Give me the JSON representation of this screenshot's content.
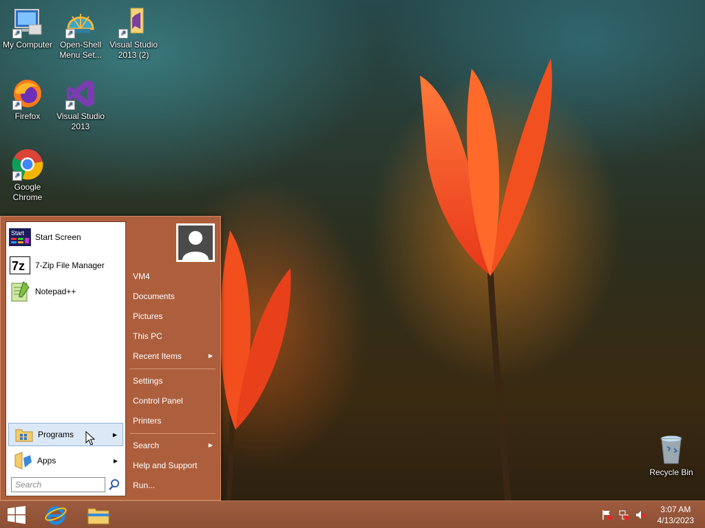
{
  "desktop": {
    "icons": [
      {
        "name": "My Computer",
        "line1": "My Computer",
        "line2": ""
      },
      {
        "name": "Open-Shell Menu Settings",
        "line1": "Open-Shell",
        "line2": "Menu Set..."
      },
      {
        "name": "Visual Studio 2013 (2)",
        "line1": "Visual Studio",
        "line2": "2013 (2)"
      },
      {
        "name": "Firefox",
        "line1": "Firefox",
        "line2": ""
      },
      {
        "name": "Visual Studio 2013",
        "line1": "Visual Studio",
        "line2": "2013"
      },
      {
        "name": "Google Chrome",
        "line1": "Google",
        "line2": "Chrome"
      },
      {
        "name": "Recycle Bin",
        "line1": "Recycle Bin",
        "line2": ""
      }
    ]
  },
  "start_menu": {
    "pinned": [
      {
        "label": "Start Screen"
      },
      {
        "label": "7-Zip File Manager"
      },
      {
        "label": "Notepad++"
      }
    ],
    "programs_label": "Programs",
    "apps_label": "Apps",
    "search_placeholder": "Search",
    "start_screen_icon_text": "Start",
    "sevenzip_icon_text": "7z",
    "right_items": [
      {
        "label": "VM4"
      },
      {
        "label": "Documents"
      },
      {
        "label": "Pictures"
      },
      {
        "label": "This PC"
      },
      {
        "label": "Recent Items"
      },
      {
        "label": "Settings"
      },
      {
        "label": "Control Panel"
      },
      {
        "label": "Printers"
      },
      {
        "label": "Search"
      },
      {
        "label": "Help and Support"
      },
      {
        "label": "Run..."
      }
    ]
  },
  "taskbar": {
    "time": "3:07 AM",
    "date": "4/13/2023"
  },
  "colors": {
    "menu_bg": "#ad5f3d",
    "taskbar_bg": "#8c4f35",
    "highlight": "#dbe8f6"
  }
}
